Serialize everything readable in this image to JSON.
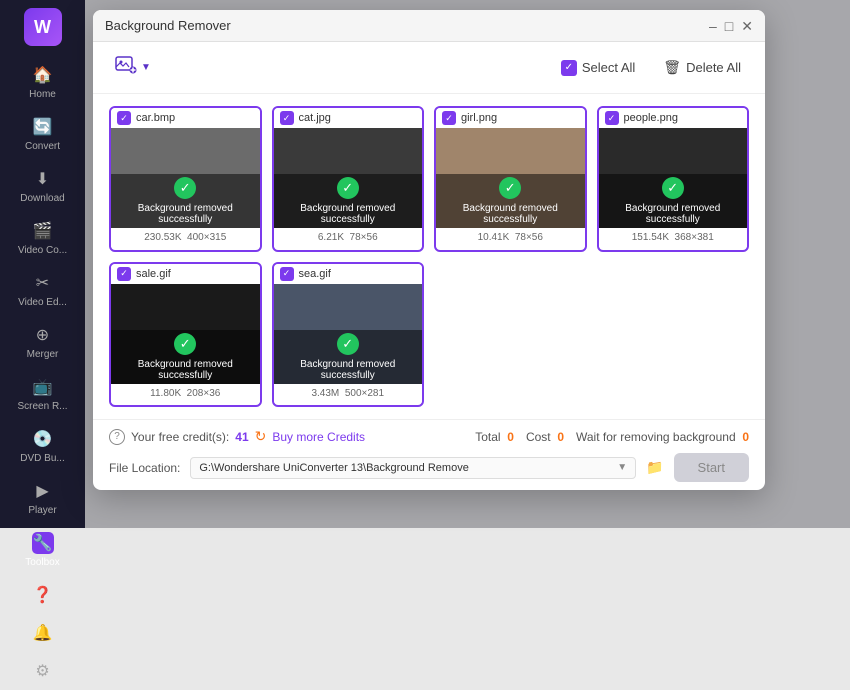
{
  "sidebar": {
    "items": [
      {
        "id": "home",
        "label": "Home",
        "icon": "🏠"
      },
      {
        "id": "convert",
        "label": "Convert",
        "icon": "🔄"
      },
      {
        "id": "download",
        "label": "Download",
        "icon": "⬇"
      },
      {
        "id": "video-comp",
        "label": "Video Co...",
        "icon": "🎬"
      },
      {
        "id": "video-edit",
        "label": "Video Ed...",
        "icon": "✂"
      },
      {
        "id": "merger",
        "label": "Merger",
        "icon": "⊕"
      },
      {
        "id": "screen-r",
        "label": "Screen R...",
        "icon": "📺"
      },
      {
        "id": "dvd-burn",
        "label": "DVD Bu...",
        "icon": "💿"
      },
      {
        "id": "player",
        "label": "Player",
        "icon": "▶"
      },
      {
        "id": "toolbox",
        "label": "Toolbox",
        "icon": "🔧",
        "active": true
      }
    ],
    "bottom_items": [
      {
        "id": "help",
        "icon": "?"
      },
      {
        "id": "notification",
        "icon": "🔔"
      },
      {
        "id": "settings",
        "icon": "⚙"
      }
    ]
  },
  "modal": {
    "title": "Background Remover",
    "select_all_label": "Select All",
    "delete_all_label": "Delete All",
    "add_tooltip": "Add files",
    "images": [
      {
        "id": "car",
        "filename": "car.bmp",
        "status": "Background removed successfully",
        "size": "230.53K",
        "dimensions": "400×315",
        "thumb_class": "thumb-car"
      },
      {
        "id": "cat",
        "filename": "cat.jpg",
        "status": "Background removed successfully",
        "size": "6.21K",
        "dimensions": "78×56",
        "thumb_class": "thumb-cat"
      },
      {
        "id": "girl",
        "filename": "girl.png",
        "status": "Background removed successfully",
        "size": "10.41K",
        "dimensions": "78×56",
        "thumb_class": "thumb-girl"
      },
      {
        "id": "people",
        "filename": "people.png",
        "status": "Background removed successfully",
        "size": "151.54K",
        "dimensions": "368×381",
        "thumb_class": "thumb-people"
      },
      {
        "id": "sale",
        "filename": "sale.gif",
        "status": "Background removed successfully",
        "size": "11.80K",
        "dimensions": "208×36",
        "thumb_class": "thumb-sale"
      },
      {
        "id": "sea",
        "filename": "sea.gif",
        "status": "Background removed successfully",
        "size": "3.43M",
        "dimensions": "500×281",
        "thumb_class": "thumb-sea"
      }
    ],
    "footer": {
      "credits_label": "Your free credit(s):",
      "credits_count": "41",
      "buy_label": "Buy more Credits",
      "total_label": "Total",
      "total_value": "0",
      "cost_label": "Cost",
      "cost_value": "0",
      "wait_label": "Wait for removing background",
      "wait_value": "0",
      "file_location_label": "File Location:",
      "file_path": "G:\\Wondershare UniConverter 13\\Background Remove",
      "start_label": "Start"
    }
  }
}
